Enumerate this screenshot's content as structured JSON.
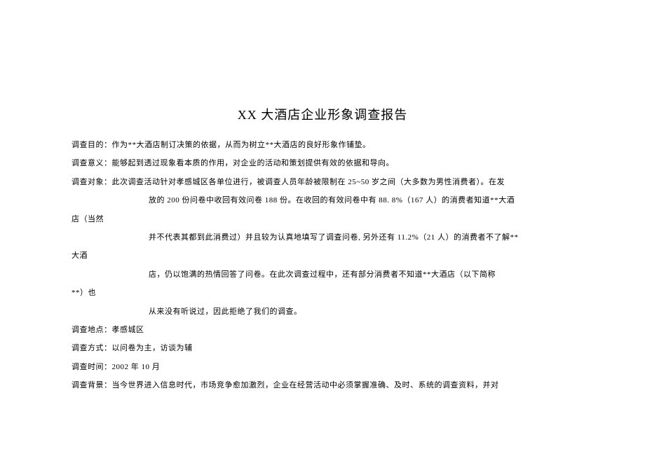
{
  "title": "XX 大酒店企业形象调查报告",
  "lines": {
    "purpose": "调查目的：作为**大酒店制订决策的依据，从而为树立**大酒店的良好形象作铺垫。",
    "meaning": "调查意义：能够起到透过现象看本质的作用，对企业的活动和策划提供有效的依据和导向。",
    "target1": "调查对象：此次调查活动针对孝感城区各单位进行，被调查人员年龄被限制在 25~50 岁之间（大多数为男性消费者）。在发",
    "target2a": "放的 200 份问卷中收回有效问卷 188 份。在收回的有效问卷中有 88. 8%（167 人）的消费者知道**大酒",
    "target2b": "店（当然",
    "target3a": "并不代表其都到此消费过）并且较为认真地填写了调查问卷, 另外还有 11.2%（21 人）的消费者不了解**",
    "target3b": "大酒",
    "target4a": "店，仍以饱满的热情回答了问卷。在此次调查过程中，还有部分消费者不知道**大酒店（以下简称",
    "target4b": "**）也",
    "target5": "从来没有听说过，因此拒绝了我们的调查。",
    "location": "调查地点：孝感城区",
    "method": "调查方式：以问卷为主，访谈为辅",
    "time": "调查时间：2002 年 10 月",
    "background": "调查背景：当今世界进入信息时代，市场竞争愈加激烈，企业在经营活动中必须掌握准确、及时、系统的调查资料，并对"
  }
}
